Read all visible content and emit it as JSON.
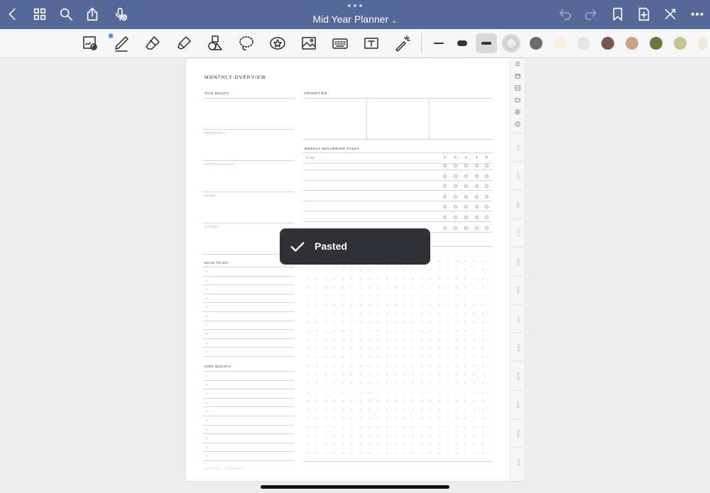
{
  "title_bar": {
    "title": "Mid Year Planner",
    "title_chevron": "⌄"
  },
  "icons": {
    "left": [
      "back-chevron-icon",
      "grid-icon",
      "search-icon",
      "share-icon",
      "mic-off-icon"
    ],
    "right": [
      "undo-icon",
      "redo-icon",
      "bookmark-icon",
      "add-page-icon",
      "close-toolbar-icon",
      "more-icon"
    ]
  },
  "toolbar": {
    "bluetooth_glyph": "✱",
    "tools": [
      "zoom-window-tool",
      "pen-tool",
      "eraser-tool",
      "highlighter-tool",
      "shapes-tool",
      "lasso-tool",
      "sticker-tool",
      "image-tool",
      "keyboard-tool",
      "text-tool",
      "laser-pointer-tool"
    ],
    "stroke_widths": [
      "thin",
      "medium",
      "thick"
    ],
    "selected_stroke": "thick",
    "colors": [
      "#d0d0d0",
      "#6c6c6c",
      "#fbefdd",
      "#e1e8e1",
      "#76594a",
      "#c9a287",
      "#717537",
      "#c9c391",
      "#efeadf"
    ],
    "selected_color": "#d0d0d0"
  },
  "planner": {
    "heading": "MONTHLY OVERVIEW",
    "this_month": "THIS MONTH",
    "personal": "PERSONAL",
    "professional": "PROFESSIONAL",
    "home": "HOME",
    "other": "OTHER",
    "priorities": "PRIORITIES",
    "weekly_recurring": "WEEKLY RECURRING TASKS",
    "task_col": "TASK",
    "week_numbers": [
      "1",
      "2",
      "3",
      "4",
      "5"
    ],
    "main_todo": "MAIN TO-DO",
    "side_quests": "SIDE QUESTS",
    "footer": "MONTHLY SUMMARY",
    "todo_nums": [
      "01",
      "02",
      "03",
      "04",
      "05",
      "06",
      "07",
      "08",
      "09",
      "10"
    ],
    "side_nums": [
      "01",
      "02",
      "03",
      "04",
      "05",
      "06",
      "07",
      "08",
      "09",
      "10"
    ]
  },
  "side_tabs": {
    "icons": [
      "list-icon",
      "calendar-icon",
      "week-icon",
      "folder-icon",
      "target-icon",
      "dollar-icon"
    ],
    "months": [
      "JUL",
      "AUG",
      "SEP",
      "OCT",
      "NOV",
      "DEC",
      "JAN",
      "FEB",
      "MAR",
      "APR",
      "MAY",
      "JUN"
    ]
  },
  "toast": {
    "message": "Pasted"
  }
}
